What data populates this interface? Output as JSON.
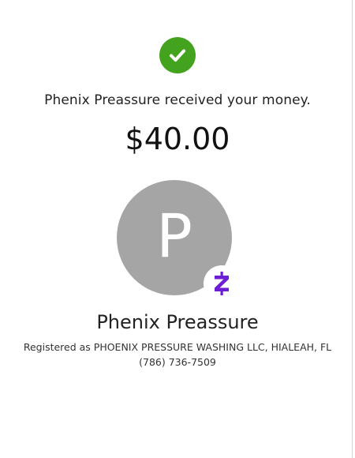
{
  "confirmation": {
    "message": "Phenix Preassure received your money.",
    "amount": "$40.00"
  },
  "recipient": {
    "avatar_letter": "P",
    "name": "Phenix Preassure",
    "registration": "Registered as PHOENIX PRESSURE WASHING LLC, HIALEAH, FL",
    "phone": "(786) 736-7509"
  },
  "icons": {
    "success": "check-circle-icon",
    "brand": "zelle-logo-icon"
  },
  "colors": {
    "success_green": "#43a31e",
    "avatar_gray": "#a5a5a5",
    "zelle_purple": "#6d1ed4"
  }
}
